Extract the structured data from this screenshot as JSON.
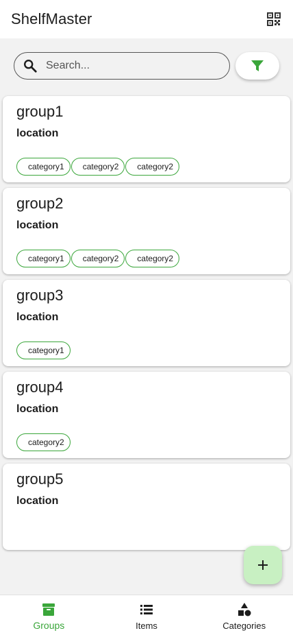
{
  "app": {
    "title": "ShelfMaster",
    "qr_icon": "qr-code-icon"
  },
  "search": {
    "placeholder": "Search...",
    "value": "",
    "filter_icon": "filter-icon"
  },
  "groups": [
    {
      "name": "group1",
      "location": "location",
      "categories": [
        "category1",
        "category2",
        "category2"
      ]
    },
    {
      "name": "group2",
      "location": "location",
      "categories": [
        "category1",
        "category2",
        "category2"
      ]
    },
    {
      "name": "group3",
      "location": "location",
      "categories": [
        "category1"
      ]
    },
    {
      "name": "group4",
      "location": "location",
      "categories": [
        "category2"
      ]
    },
    {
      "name": "group5",
      "location": "location",
      "categories": []
    }
  ],
  "fab": {
    "icon": "plus-icon"
  },
  "bottom_nav": {
    "items": [
      {
        "label": "Groups",
        "icon": "archive-box-icon",
        "active": true
      },
      {
        "label": "Items",
        "icon": "list-icon",
        "active": false
      },
      {
        "label": "Categories",
        "icon": "shapes-icon",
        "active": false
      }
    ]
  },
  "colors": {
    "accent": "#3aa63a",
    "background": "#f2f2f2",
    "surface": "#ffffff",
    "fab": "#c8f0c2"
  }
}
